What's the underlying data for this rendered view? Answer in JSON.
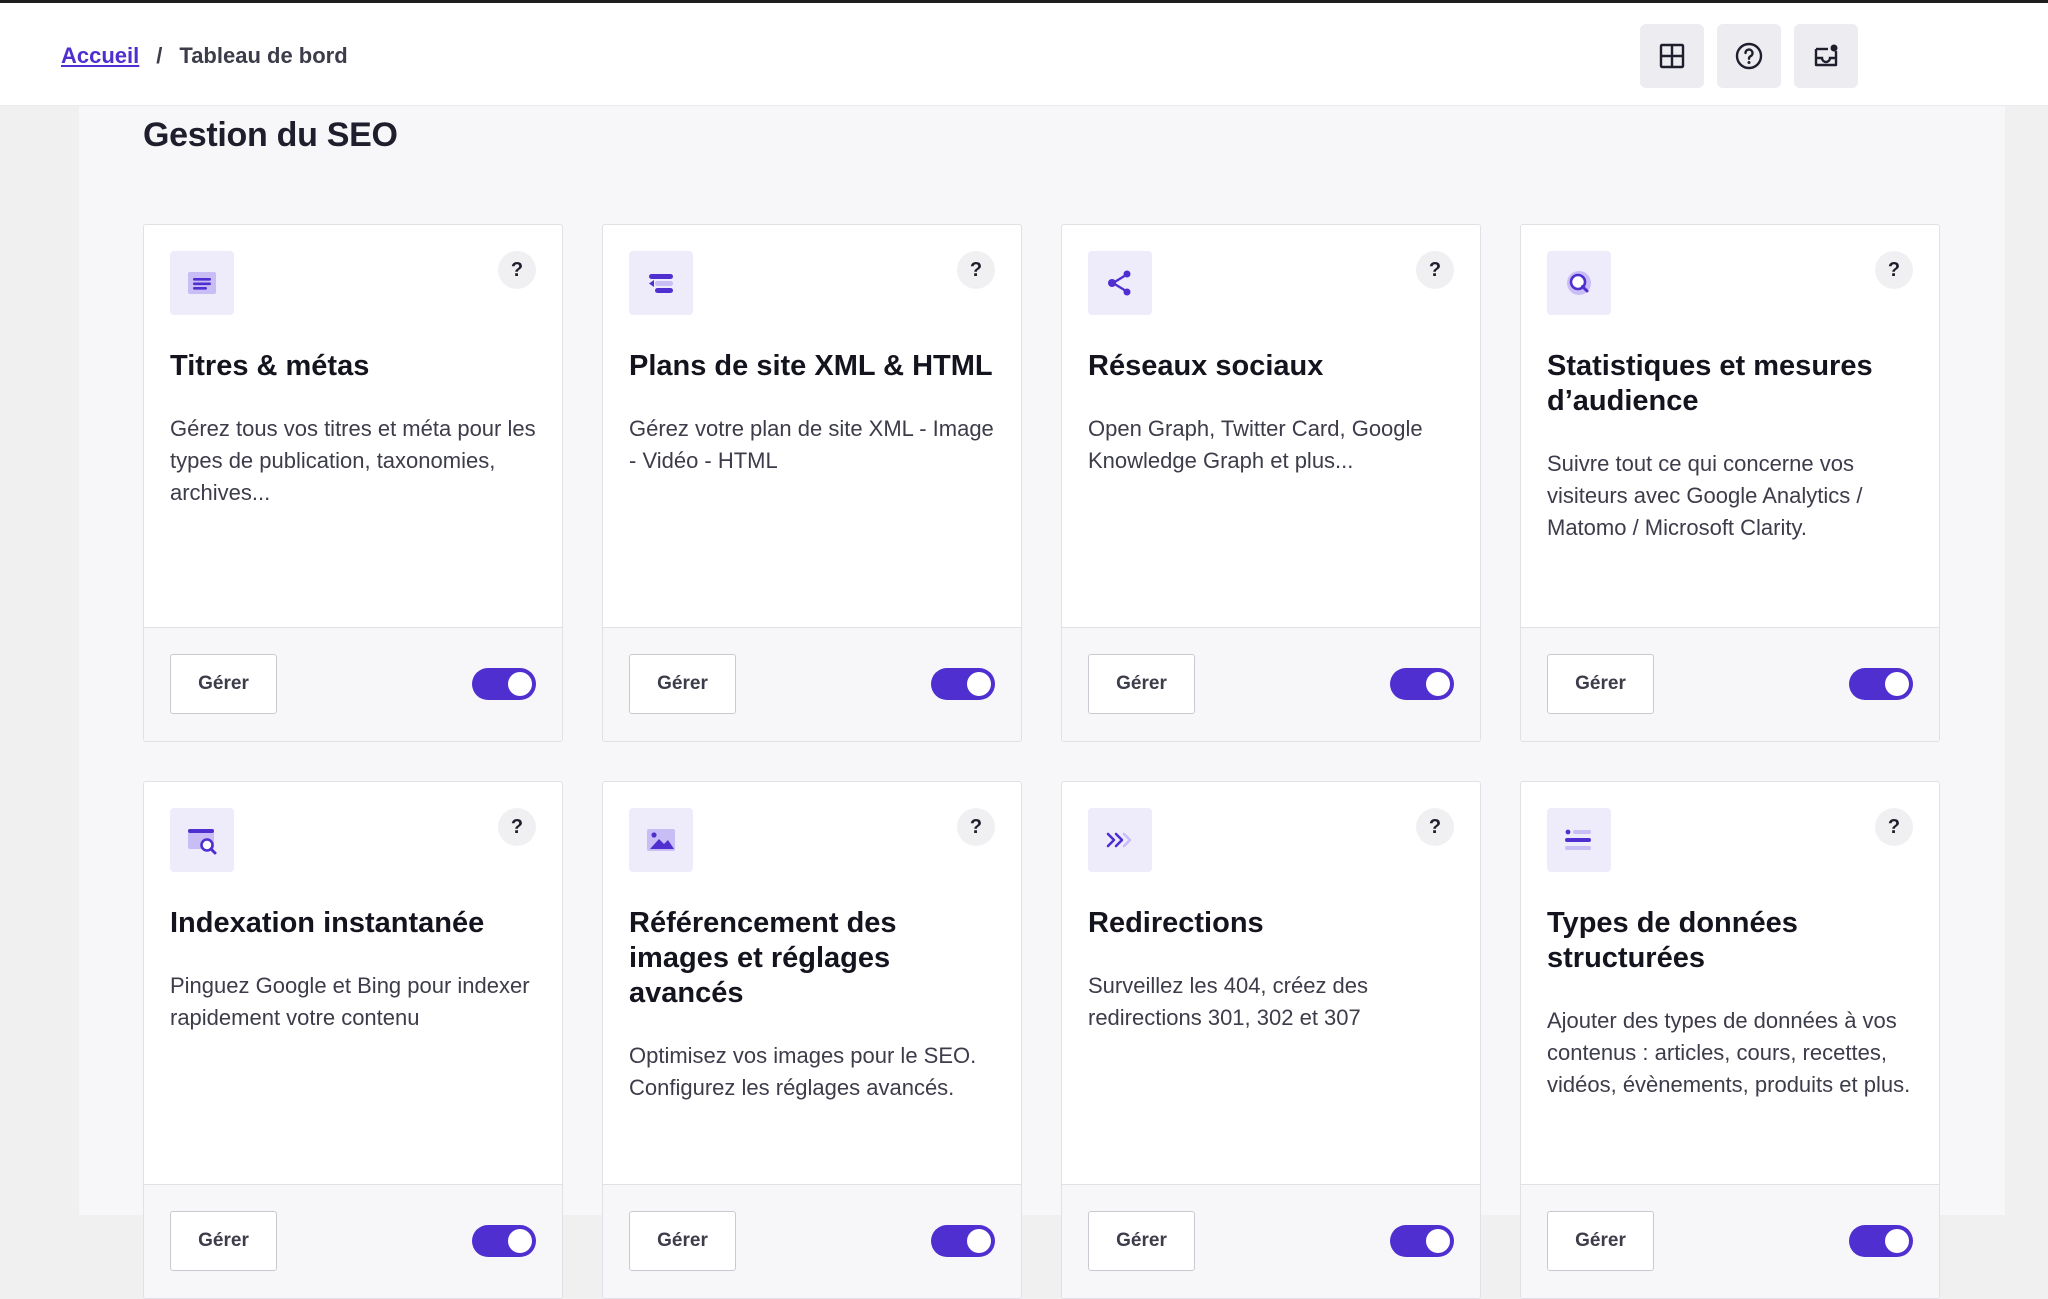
{
  "breadcrumb": {
    "home": "Accueil",
    "separator": "/",
    "current": "Tableau de bord"
  },
  "header_icons": [
    "grid-icon",
    "help-circle-icon",
    "inbox-notification-icon"
  ],
  "page_title": "Gestion du SEO",
  "colors": {
    "accent": "#4f2fd0",
    "icon_bg": "#eeebfb",
    "toggle_on": "#4f2fd0"
  },
  "cards": [
    {
      "icon": "titles-metas-icon",
      "help": "?",
      "title": "Titres & métas",
      "desc": "Gérez tous vos titres et méta pour les types de publication, taxonomies, archives...",
      "manage_label": "Gérer",
      "enabled": true
    },
    {
      "icon": "sitemap-icon",
      "help": "?",
      "title": "Plans de site XML & HTML",
      "desc": "Gérez votre plan de site XML - Image - Vidéo - HTML",
      "manage_label": "Gérer",
      "enabled": true
    },
    {
      "icon": "share-icon",
      "help": "?",
      "title": "Réseaux sociaux",
      "desc": "Open Graph, Twitter Card, Google Knowledge Graph et plus...",
      "manage_label": "Gérer",
      "enabled": true
    },
    {
      "icon": "analytics-search-icon",
      "help": "?",
      "title": "Statistiques et mesures d’audience",
      "desc": "Suivre tout ce qui concerne vos visiteurs avec Google Analytics / Matomo / Microsoft Clarity.",
      "manage_label": "Gérer",
      "enabled": true
    },
    {
      "icon": "instant-indexing-icon",
      "help": "?",
      "title": "Indexation instantanée",
      "desc": "Pinguez Google et Bing pour indexer rapidement votre contenu",
      "manage_label": "Gérer",
      "enabled": true
    },
    {
      "icon": "image-icon",
      "help": "?",
      "title": "Référencement des images et réglages avancés",
      "desc": "Optimisez vos images pour le SEO. Configurez les réglages avancés.",
      "manage_label": "Gérer",
      "enabled": true
    },
    {
      "icon": "redirect-arrows-icon",
      "help": "?",
      "title": "Redirections",
      "desc": "Surveillez les 404, créez des redirections 301, 302 et 307",
      "manage_label": "Gérer",
      "enabled": true
    },
    {
      "icon": "structured-data-icon",
      "help": "?",
      "title": "Types de données structurées",
      "desc": "Ajouter des types de données à vos contenus : articles, cours, recettes, vidéos, évènements, produits et plus.",
      "manage_label": "Gérer",
      "enabled": true
    }
  ]
}
